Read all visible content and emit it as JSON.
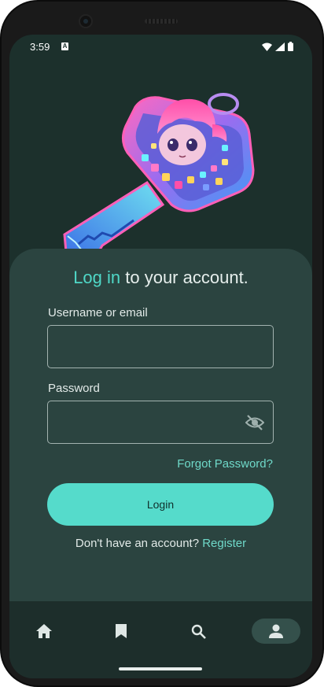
{
  "status_bar": {
    "time": "3:59",
    "notification_badge": "A",
    "icons": [
      "wifi-icon",
      "signal-icon",
      "battery-icon"
    ]
  },
  "hero": {
    "image": "anime-girl-key-illustration"
  },
  "login": {
    "title_accent": "Log in",
    "title_rest": " to your account.",
    "username_label": "Username or email",
    "username_value": "",
    "password_label": "Password",
    "password_value": "",
    "password_toggle_icon": "eye-off-icon",
    "forgot_password": "Forgot Password?",
    "login_button": "Login",
    "no_account_text": "Don't have an account? ",
    "register_link": "Register"
  },
  "bottom_nav": {
    "items": [
      {
        "icon": "home-icon",
        "active": false
      },
      {
        "icon": "bookmark-icon",
        "active": false
      },
      {
        "icon": "search-icon",
        "active": false
      },
      {
        "icon": "person-icon",
        "active": true
      }
    ]
  },
  "colors": {
    "background": "#1c302c",
    "card": "#2b4440",
    "accent": "#55dbcb",
    "nav_background": "#1d2e2b",
    "nav_active_pill": "#34504b"
  }
}
